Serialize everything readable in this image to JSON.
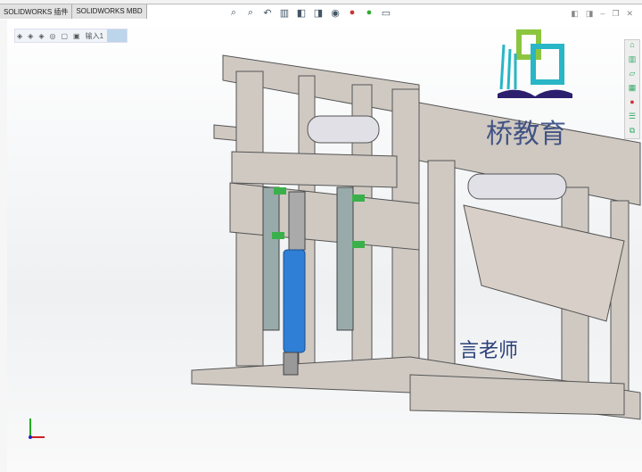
{
  "tabs": [
    {
      "label": "SOLIDWORKS 插件"
    },
    {
      "label": "SOLIDWORKS MBD"
    }
  ],
  "breadcrumb": {
    "current": "输入1"
  },
  "watermark": {
    "brand": "桥教育",
    "teacher": "言老师"
  },
  "colors": {
    "accent": "#bcd5ea",
    "part": "#c9c3bd",
    "cylinder": "#2f7fd6",
    "guide": "#3ab04a"
  }
}
